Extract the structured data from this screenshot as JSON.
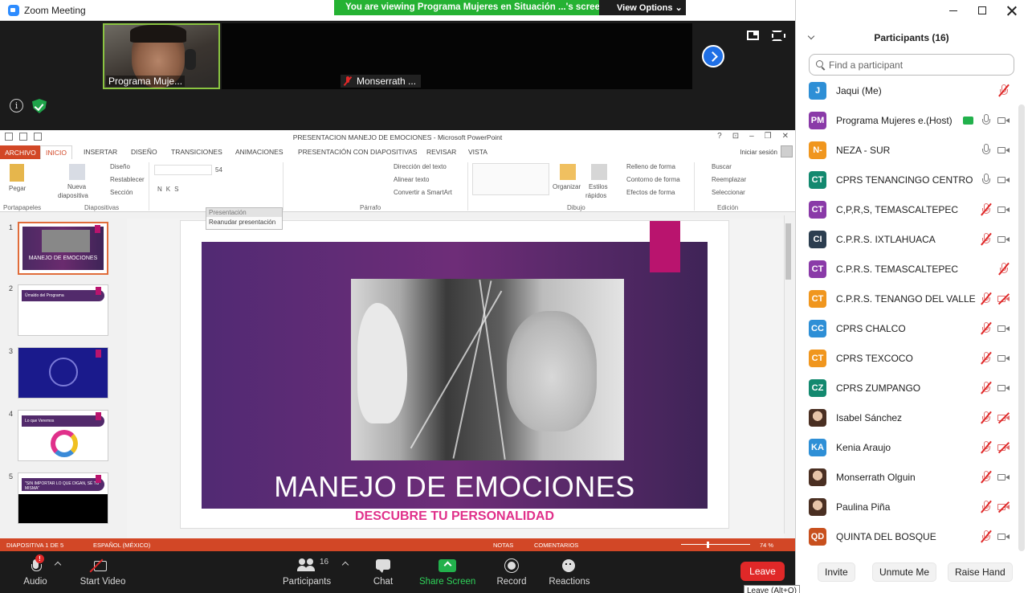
{
  "window": {
    "title": "Zoom Meeting"
  },
  "share_banner": {
    "message": "You are viewing Programa Mujeres en Situación ...'s screen",
    "view_options": "View Options"
  },
  "videos": {
    "self_label": "Programa Muje...",
    "other_label": "Monserrath ..."
  },
  "powerpoint": {
    "title": "PRESENTACION MANEJO DE EMOCIONES - Microsoft PowerPoint",
    "window_buttons": [
      "?",
      "⊡",
      "–",
      "❐",
      "✕"
    ],
    "tabs": [
      "ARCHIVO",
      "INICIO",
      "INSERTAR",
      "DISEÑO",
      "TRANSICIONES",
      "ANIMACIONES",
      "PRESENTACIÓN CON DIAPOSITIVAS",
      "REVISAR",
      "VISTA"
    ],
    "sign_in": "Iniciar sesión",
    "ribbon": {
      "paste": "Pegar",
      "new_slide_1": "Nueva",
      "new_slide_2": "diapositiva",
      "layout": "Diseño",
      "reset": "Restablecer",
      "section": "Sección",
      "font_size": "54",
      "text_direction": "Dirección del texto",
      "align_text": "Alinear texto",
      "smartart": "Convertir a SmartArt",
      "arrange": "Organizar",
      "quick_styles_1": "Estilos",
      "quick_styles_2": "rápidos",
      "shape_fill": "Relleno de forma",
      "shape_outline": "Contorno de forma",
      "shape_effects": "Efectos de forma",
      "find": "Buscar",
      "replace": "Reemplazar",
      "select": "Seleccionar",
      "groups": [
        "Portapapeles",
        "Diapositivas",
        "Párrafo",
        "Dibujo",
        "Edición"
      ]
    },
    "presentation_popup": {
      "header": "Presentación",
      "resume": "Reanudar presentación"
    },
    "slide_numbers": [
      "1",
      "2",
      "3",
      "4",
      "5"
    ],
    "thumb_texts": {
      "s1": "MANEJO DE EMOCIONES",
      "s2": "Ümaldo del Programa",
      "s4": "Lo que Veremos",
      "s5": "\"SIN IMPORTAR LO QUE DIGAN, SÉ TU MISMA\""
    },
    "slide": {
      "title": "MANEJO DE EMOCIONES",
      "subtitle": "DESCUBRE TU PERSONALIDAD"
    },
    "status": {
      "slide": "DIAPOSITIVA 1 DE 5",
      "language": "ESPAÑOL (MÉXICO)",
      "notes": "NOTAS",
      "comments": "COMENTARIOS",
      "zoom": "74 %"
    }
  },
  "controls": {
    "audio": "Audio",
    "audio_alert": "!",
    "video": "Start Video",
    "participants": "Participants",
    "participants_count": "16",
    "chat": "Chat",
    "share": "Share Screen",
    "record": "Record",
    "reactions": "Reactions",
    "leave": "Leave",
    "leave_tooltip": "Leave (Alt+Q)"
  },
  "panel": {
    "title": "Participants (16)",
    "search_placeholder": "Find a participant",
    "invite": "Invite",
    "unmute": "Unmute Me",
    "raise_hand": "Raise Hand",
    "participants": [
      {
        "initials": "J",
        "name": "Jaqui (Me)",
        "color": "#2e8fd6",
        "mic": "off",
        "cam": "none"
      },
      {
        "initials": "PM",
        "name": "Programa Mujeres e...",
        "tag": "(Host)",
        "color": "#8a3aa8",
        "mic": "on",
        "cam": "on",
        "sharing": true
      },
      {
        "initials": "N-",
        "name": "NEZA - SUR",
        "color": "#f0961e",
        "mic": "on",
        "cam": "on"
      },
      {
        "initials": "CT",
        "name": "CPRS  TENANCINGO CENTRO",
        "color": "#13896f",
        "mic": "on",
        "cam": "on"
      },
      {
        "initials": "CT",
        "name": "C,P,R,S, TEMASCALTEPEC",
        "color": "#8a3aa8",
        "mic": "off",
        "cam": "on"
      },
      {
        "initials": "CI",
        "name": "C.P.R.S. IXTLAHUACA",
        "color": "#2c3e50",
        "mic": "off",
        "cam": "on"
      },
      {
        "initials": "CT",
        "name": "C.P.R.S. TEMASCALTEPEC",
        "color": "#8a3aa8",
        "mic": "off",
        "cam": "none"
      },
      {
        "initials": "CT",
        "name": "C.P.R.S. TENANGO DEL VALLE",
        "color": "#f0961e",
        "mic": "off",
        "cam": "off"
      },
      {
        "initials": "CC",
        "name": "CPRS CHALCO",
        "color": "#2e8fd6",
        "mic": "off",
        "cam": "on"
      },
      {
        "initials": "CT",
        "name": "CPRS TEXCOCO",
        "color": "#f0961e",
        "mic": "off",
        "cam": "on"
      },
      {
        "initials": "CZ",
        "name": "CPRS ZUMPANGO",
        "color": "#13896f",
        "mic": "off",
        "cam": "on"
      },
      {
        "initials": "",
        "name": "Isabel Sánchez",
        "photo": true,
        "mic": "off",
        "cam": "off"
      },
      {
        "initials": "KA",
        "name": "Kenia Araujo",
        "color": "#2e8fd6",
        "mic": "off",
        "cam": "off"
      },
      {
        "initials": "",
        "name": "Monserrath Olguin",
        "photo": true,
        "mic": "off",
        "cam": "on"
      },
      {
        "initials": "",
        "name": "Paulina Piña",
        "photo": true,
        "mic": "off",
        "cam": "off"
      },
      {
        "initials": "QD",
        "name": "QUINTA DEL BOSQUE",
        "color": "#c8501e",
        "mic": "off",
        "cam": "on"
      }
    ]
  }
}
